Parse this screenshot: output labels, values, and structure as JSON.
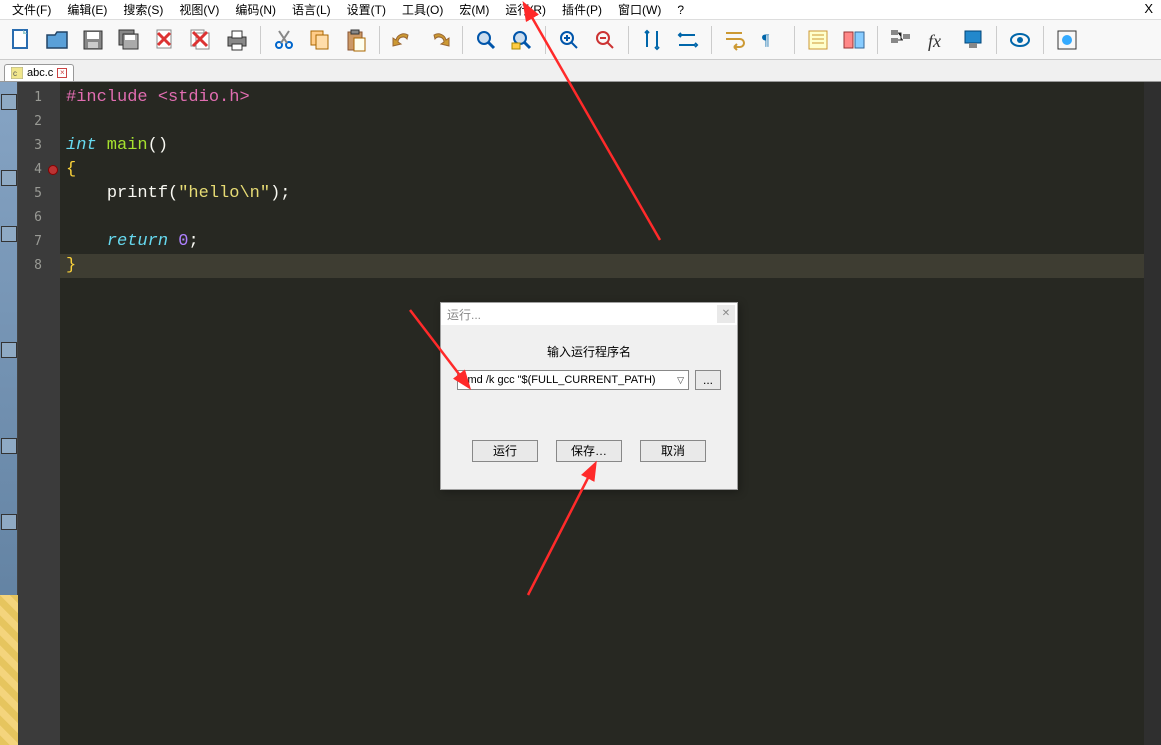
{
  "menu": {
    "items": [
      "文件(F)",
      "编辑(E)",
      "搜索(S)",
      "视图(V)",
      "编码(N)",
      "语言(L)",
      "设置(T)",
      "工具(O)",
      "宏(M)",
      "运行(R)",
      "插件(P)",
      "窗口(W)",
      "?"
    ],
    "close": "X"
  },
  "toolbar": {
    "icons": [
      "new-file-icon",
      "open-file-icon",
      "save-icon",
      "save-all-icon",
      "close-file-icon",
      "close-all-icon",
      "print-icon",
      "cut-icon",
      "copy-icon",
      "paste-icon",
      "undo-icon",
      "redo-icon",
      "find-icon",
      "replace-icon",
      "zoom-in-icon",
      "zoom-out-icon",
      "sync-v-icon",
      "sync-h-icon",
      "wordwrap-icon",
      "show-chars-icon",
      "indent-guide-icon",
      "lang-icon",
      "folder-tree-icon",
      "function-list-icon",
      "doc-map-icon",
      "monitor-icon",
      "record-icon"
    ]
  },
  "tab": {
    "filename": "abc.c"
  },
  "gutter": {
    "lines": [
      "1",
      "2",
      "3",
      "4",
      "5",
      "6",
      "7",
      "8"
    ]
  },
  "code": {
    "l1_include": "#include ",
    "l1_header": "<stdio.h>",
    "l3_type": "int",
    "l3_name": " main",
    "l3_paren": "()",
    "l4_brace": "{",
    "l5_indent": "    ",
    "l5_func": "printf",
    "l5_paren_o": "(",
    "l5_str": "\"hello\\n\"",
    "l5_paren_c": ")",
    "l5_semi": ";",
    "l7_indent": "    ",
    "l7_ret": "return",
    "l7_sp": " ",
    "l7_num": "0",
    "l7_semi": ";",
    "l8_brace": "}"
  },
  "dialog": {
    "title": "运行...",
    "label": "输入运行程序名",
    "command": "cmd /k gcc \"$(FULL_CURRENT_PATH)",
    "browse": "...",
    "run_btn": "运行",
    "save_btn": "保存…",
    "cancel_btn": "取消"
  }
}
